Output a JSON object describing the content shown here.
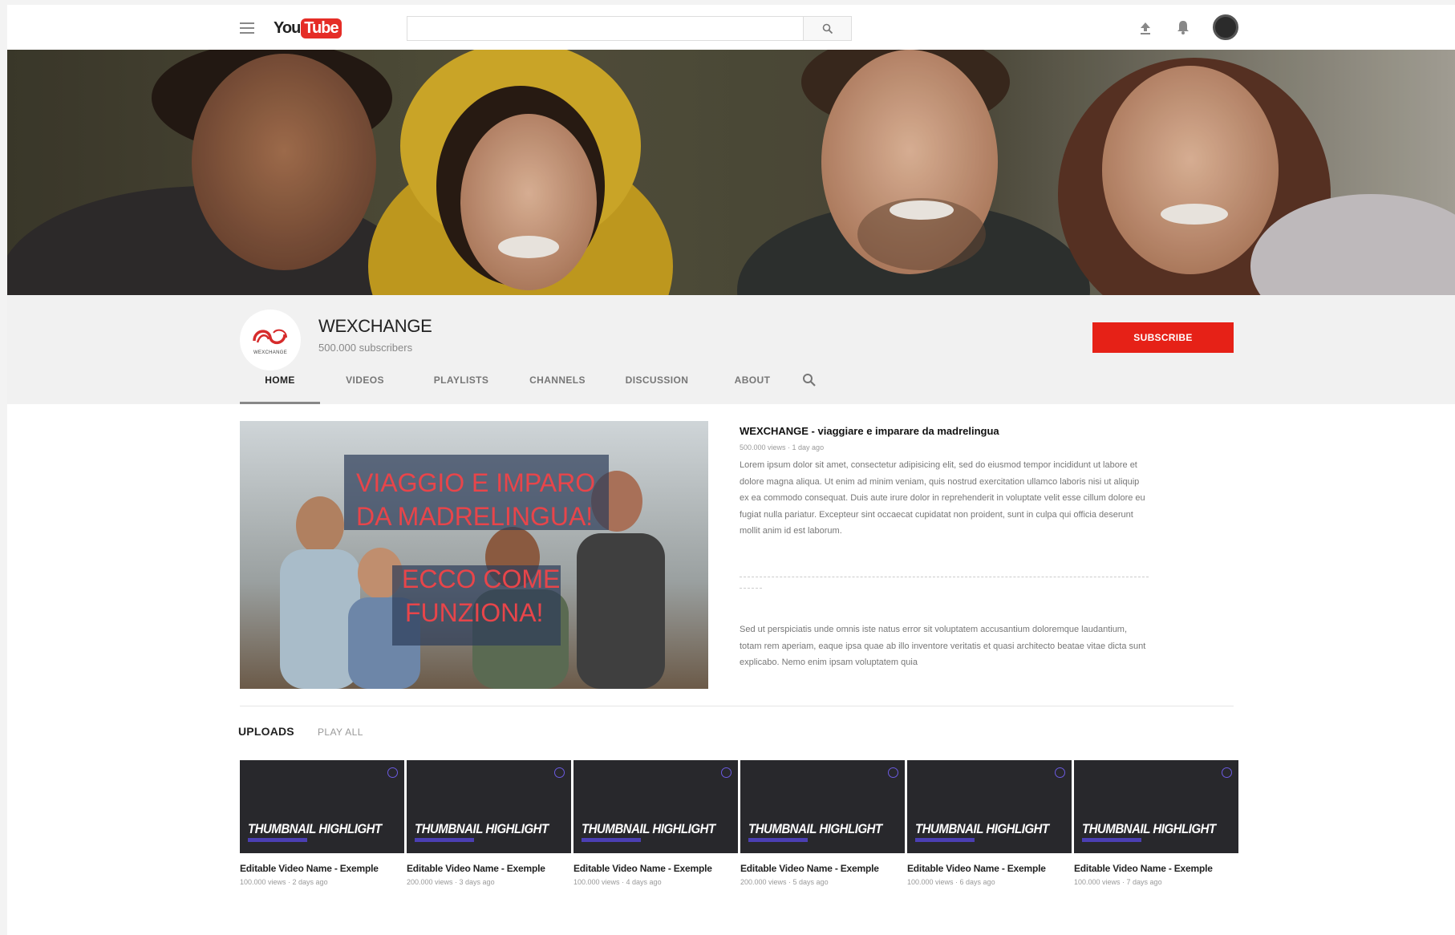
{
  "header": {
    "logo_you": "You",
    "logo_tube": "Tube",
    "search_placeholder": "",
    "icons": [
      "menu-icon",
      "search-icon",
      "upload-icon",
      "bell-icon",
      "avatar"
    ]
  },
  "channel": {
    "name": "WEXCHANGE",
    "subscribers": "500.000 subscribers",
    "avatar_text": "WEXCHANGE",
    "subscribe_label": "SUBSCRIBE",
    "tabs": [
      {
        "label": "HOME",
        "active": true
      },
      {
        "label": "VIDEOS",
        "active": false
      },
      {
        "label": "PLAYLISTS",
        "active": false
      },
      {
        "label": "CHANNELS",
        "active": false
      },
      {
        "label": "DISCUSSION",
        "active": false
      },
      {
        "label": "ABOUT",
        "active": false
      }
    ]
  },
  "featured": {
    "thumb_line1": "VIAGGIO E IMPARO",
    "thumb_line2": "DA MADRELINGUA!",
    "thumb_line3": "ECCO COME",
    "thumb_line4": "FUNZIONA!",
    "title": "WEXCHANGE - viaggiare e imparare da madrelingua",
    "meta": "500.000 views · 1 day ago",
    "description": "Lorem ipsum dolor sit amet, consectetur adipisicing elit, sed do eiusmod tempor incididunt ut labore et dolore magna aliqua. Ut enim ad minim veniam, quis nostrud exercitation ullamco laboris nisi ut aliquip ex ea commodo consequat. Duis aute irure dolor in reprehenderit in voluptate velit esse cillum dolore eu fugiat nulla pariatur. Excepteur sint occaecat cupidatat non proident, sunt in culpa qui officia deserunt mollit anim id est laborum.",
    "description2": "Sed ut perspiciatis unde omnis iste natus error sit voluptatem accusantium doloremque laudantium, totam rem aperiam, eaque ipsa quae ab illo inventore veritatis et quasi architecto beatae vitae dicta sunt explicabo. Nemo enim ipsam voluptatem quia"
  },
  "uploads": {
    "label": "UPLOADS",
    "play_all": "PLAY ALL",
    "videos": [
      {
        "thumb": "THUMBNAIL HIGHLIGHT",
        "name": "Editable Video Name - Exemple",
        "meta": "100.000 views · 2 days ago"
      },
      {
        "thumb": "THUMBNAIL HIGHLIGHT",
        "name": "Editable Video Name - Exemple",
        "meta": "200.000 views · 3 days ago"
      },
      {
        "thumb": "THUMBNAIL HIGHLIGHT",
        "name": "Editable Video Name - Exemple",
        "meta": "100.000 views · 4 days ago"
      },
      {
        "thumb": "THUMBNAIL HIGHLIGHT",
        "name": "Editable Video Name - Exemple",
        "meta": "200.000 views · 5 days ago"
      },
      {
        "thumb": "THUMBNAIL HIGHLIGHT",
        "name": "Editable Video Name - Exemple",
        "meta": "100.000 views · 6 days ago"
      },
      {
        "thumb": "THUMBNAIL HIGHLIGHT",
        "name": "Editable Video Name - Exemple",
        "meta": "100.000 views · 7 days ago"
      }
    ]
  },
  "colors": {
    "brand_red": "#e62117",
    "thumb_bg": "#28282c",
    "accent_purple": "#4b3fb3",
    "thumb_text_red": "#e8454a"
  }
}
